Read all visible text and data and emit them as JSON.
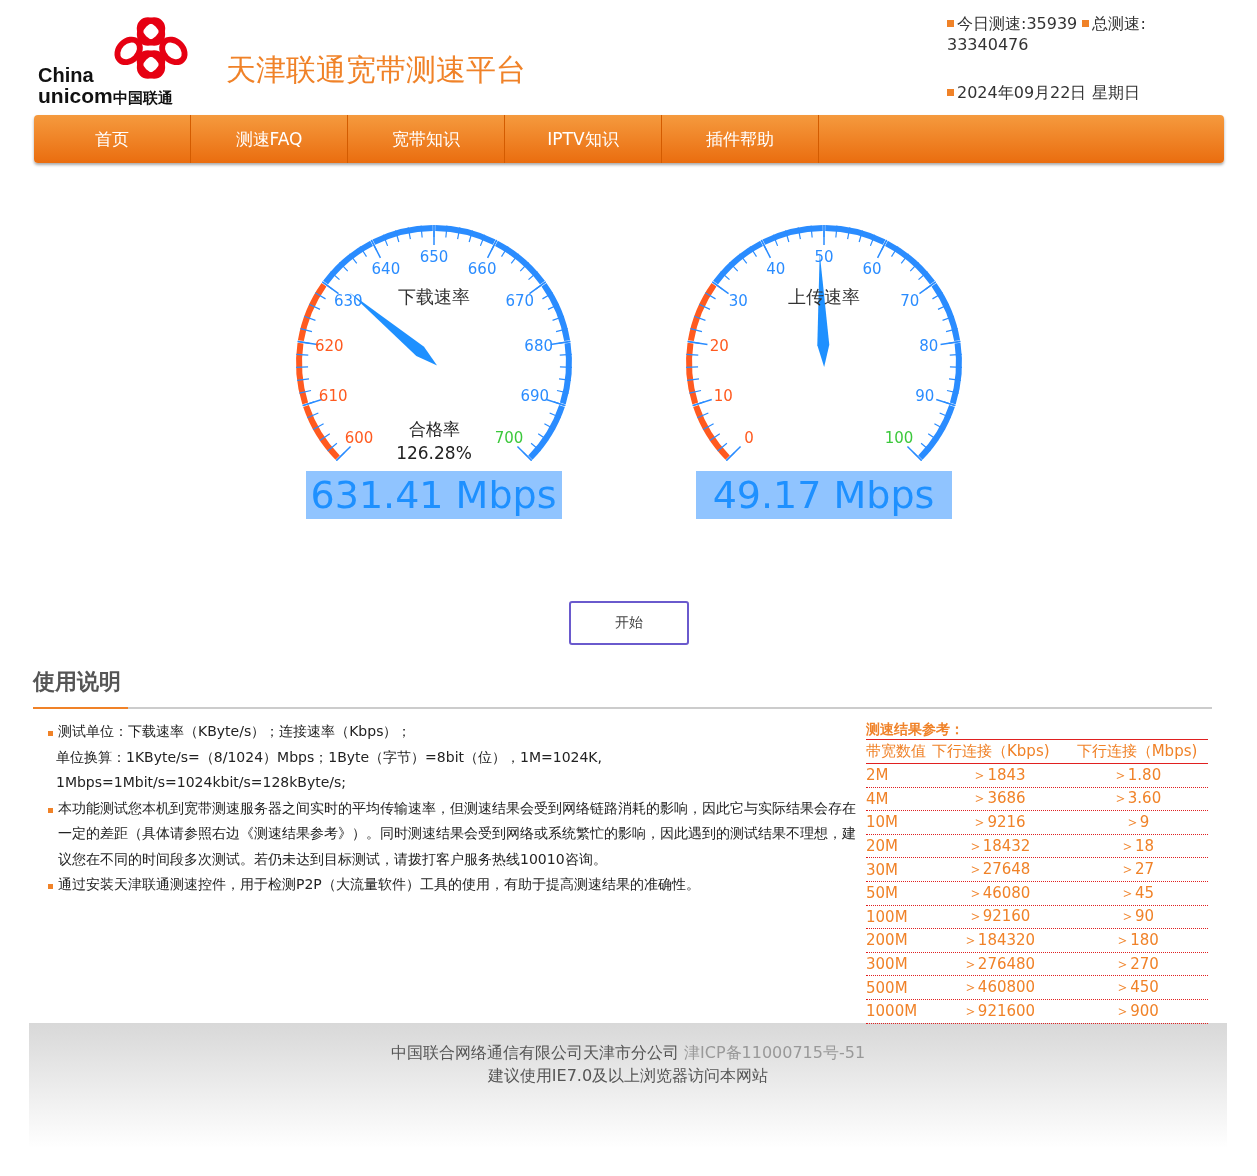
{
  "logo": {
    "line_1": "China",
    "line_2": "unicom",
    "line_3": "中国联通"
  },
  "site_title": "天津联通宽带测速平台",
  "stats": {
    "today": "今日测速:35939",
    "total_label": "总测速:",
    "total_value": "33340476",
    "date": "2024年09月22日 星期日"
  },
  "nav": [
    "首页",
    "测速FAQ",
    "宽带知识",
    "IPTV知识",
    "插件帮助"
  ],
  "gauges": [
    {
      "title": "下载速率",
      "level": 0.3141,
      "reading": "631.41 Mbps",
      "pass_rate_label": "合格率",
      "pass_rate": "126.28%",
      "labels": [
        {
          "text": "600",
          "color": "#ff5a1f"
        },
        {
          "text": "610",
          "color": "#ff5a1f"
        },
        {
          "text": "620",
          "color": "#ff5a1f"
        },
        {
          "text": "630",
          "color": "#2a8cff"
        },
        {
          "text": "640",
          "color": "#2a8cff"
        },
        {
          "text": "650",
          "color": "#2a8cff"
        },
        {
          "text": "660",
          "color": "#2a8cff"
        },
        {
          "text": "670",
          "color": "#2a8cff"
        },
        {
          "text": "680",
          "color": "#2a8cff"
        },
        {
          "text": "690",
          "color": "#2a8cff"
        },
        {
          "text": "700",
          "color": "#3cc83c"
        }
      ]
    },
    {
      "title": "上传速率",
      "level": 0.4917,
      "reading": "49.17 Mbps",
      "labels": [
        {
          "text": "0",
          "color": "#ff5a1f"
        },
        {
          "text": "10",
          "color": "#ff5a1f"
        },
        {
          "text": "20",
          "color": "#ff5a1f"
        },
        {
          "text": "30",
          "color": "#2a8cff"
        },
        {
          "text": "40",
          "color": "#2a8cff"
        },
        {
          "text": "50",
          "color": "#2a8cff"
        },
        {
          "text": "60",
          "color": "#2a8cff"
        },
        {
          "text": "70",
          "color": "#2a8cff"
        },
        {
          "text": "80",
          "color": "#2a8cff"
        },
        {
          "text": "90",
          "color": "#2a8cff"
        },
        {
          "text": "100",
          "color": "#3cc83c"
        }
      ]
    }
  ],
  "start_button": "开始",
  "section_title": "使用说明",
  "instructions": [
    {
      "bullet": true,
      "text": "测试单位：下载速率（KByte/s）；连接速率（Kbps）；"
    },
    {
      "bullet": false,
      "text": "单位换算：1KByte/s=（8/1024）Mbps；1Byte（字节）=8bit（位），1M=1024K, 1Mbps=1Mbit/s=1024kbit/s=128kByte/s;"
    },
    {
      "bullet": true,
      "text": "本功能测试您本机到宽带测速服务器之间实时的平均传输速率，但测速结果会受到网络链路消耗的影响，因此它与实际结果会存在一定的差距（具体请参照右边《测速结果参考》）。同时测速结果会受到网络或系统繁忙的影响，因此遇到的测试结果不理想，建议您在不同的时间段多次测试。若仍未达到目标测试，请拨打客户服务热线10010咨询。"
    },
    {
      "bullet": true,
      "text": "通过安装天津联通测速控件，用于检测P2P（大流量软件）工具的使用，有助于提高测速结果的准确性。"
    }
  ],
  "reference": {
    "title": "测速结果参考：",
    "columns": [
      "带宽数值",
      "下行连接（Kbps)",
      "下行连接（Mbps)"
    ],
    "rows": [
      [
        "2M",
        "＞1843",
        "＞1.80"
      ],
      [
        "4M",
        "＞3686",
        "＞3.60"
      ],
      [
        "10M",
        "＞9216",
        "＞9"
      ],
      [
        "20M",
        "＞18432",
        "＞18"
      ],
      [
        "30M",
        "＞27648",
        "＞27"
      ],
      [
        "50M",
        "＞46080",
        "＞45"
      ],
      [
        "100M",
        "＞92160",
        "＞90"
      ],
      [
        "200M",
        "＞184320",
        "＞180"
      ],
      [
        "300M",
        "＞276480",
        "＞270"
      ],
      [
        "500M",
        "＞460800",
        "＞450"
      ],
      [
        "1000M",
        "＞921600",
        "＞900"
      ]
    ]
  },
  "footer": {
    "company": "中国联合网络通信有限公司天津市分公司",
    "icp": "津ICP备11000715号-51",
    "note": "建议使用IE7.0及以上浏览器访问本网站"
  }
}
